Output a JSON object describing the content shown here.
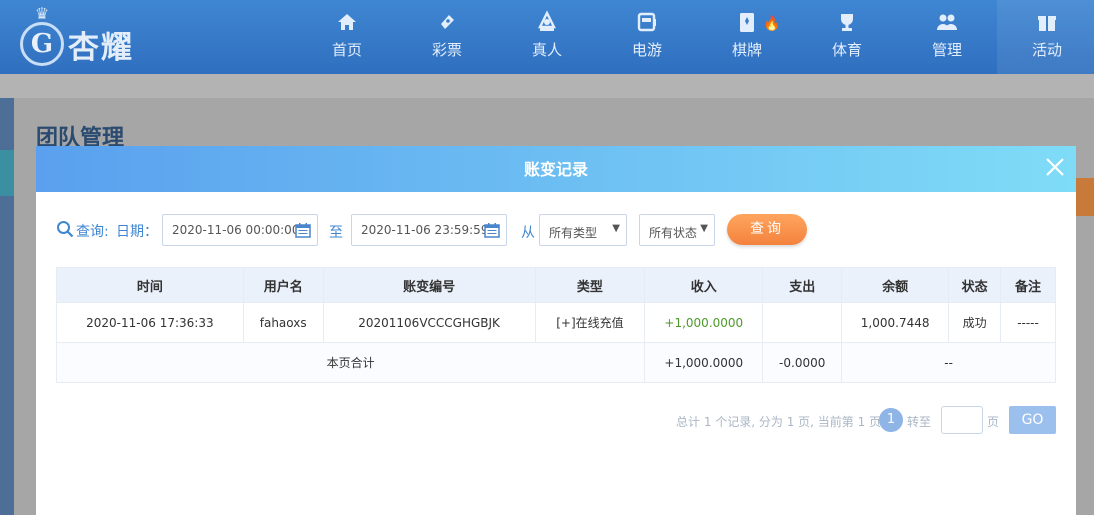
{
  "brand": {
    "name": "杏耀",
    "mark": "G"
  },
  "nav": [
    {
      "label": "首页",
      "icon": "home-icon"
    },
    {
      "label": "彩票",
      "icon": "lottery-icon"
    },
    {
      "label": "真人",
      "icon": "live-dealer-icon"
    },
    {
      "label": "电游",
      "icon": "slot-machine-icon"
    },
    {
      "label": "棋牌",
      "icon": "cards-icon",
      "hot": true
    },
    {
      "label": "体育",
      "icon": "trophy-icon"
    },
    {
      "label": "管理",
      "icon": "users-icon"
    },
    {
      "label": "活动",
      "icon": "gift-icon"
    }
  ],
  "page": {
    "title": "团队管理"
  },
  "modal": {
    "title": "账变记录",
    "filter": {
      "query_label": "查询:",
      "date_label": "日期：",
      "start": "2020-11-06 00:00:00",
      "to_label": "至",
      "end": "2020-11-06 23:59:59",
      "from_label": "从",
      "type_select": "所有类型",
      "status_select": "所有状态",
      "query_button": "查询"
    },
    "table": {
      "headers": [
        "时间",
        "用户名",
        "账变编号",
        "类型",
        "收入",
        "支出",
        "余额",
        "状态",
        "备注"
      ],
      "rows": [
        [
          "2020-11-06 17:36:33",
          "fahaoxs",
          "20201106VCCCGHGBJK",
          "[+]在线充值",
          "+1,000.0000",
          "",
          "1,000.7448",
          "成功",
          "-----"
        ]
      ],
      "summary": {
        "label": "本页合计",
        "income": "+1,000.0000",
        "expense": "-0.0000",
        "rest": "--"
      }
    },
    "pager": {
      "info": "总计 1 个记录, 分为 1 页, 当前第 1 页",
      "current": "1",
      "goto_label": "转至",
      "unit": "页",
      "go": "GO"
    }
  },
  "colors": {
    "nav": "#3f86d2",
    "header_start": "#5aa0ee",
    "header_end": "#7fdcf7",
    "income": "#4e9a2a",
    "query_button": "#f3823d"
  }
}
